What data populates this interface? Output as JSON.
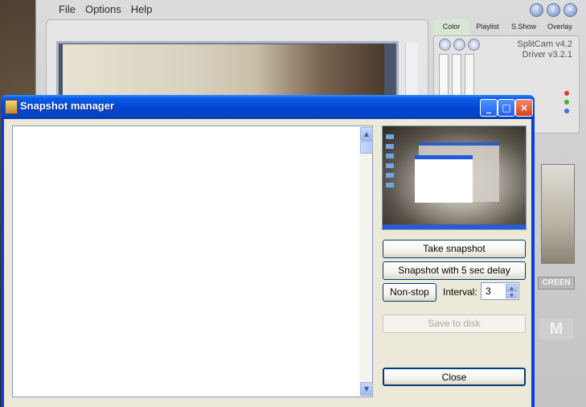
{
  "background_app": {
    "menu": [
      "File",
      "Options",
      "Help"
    ],
    "tabs": [
      "Color",
      "Playlist",
      "S.Show",
      "Overlay"
    ],
    "version_line1": "SplitCam v4.2",
    "version_line2": "Driver v3.2.1",
    "screen_button": "CREEN",
    "logo_fragment": "M"
  },
  "dialog": {
    "title": "Snapshot manager",
    "take_snapshot": "Take snapshot",
    "snapshot_delay": "Snapshot with 5 sec delay",
    "non_stop": "Non-stop",
    "interval_label": "Interval:",
    "interval_value": "3",
    "save_to_disk": "Save to disk",
    "close": "Close"
  },
  "colors": {
    "titlebar": "#0548d6",
    "dialog_face": "#ece9d8",
    "status_red": "#e03a3a",
    "status_green": "#3ab53a",
    "status_blue": "#3a6ee0"
  }
}
